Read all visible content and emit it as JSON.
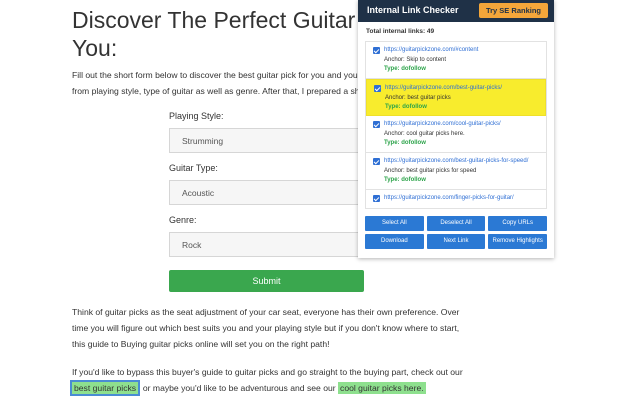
{
  "page": {
    "title_line1": "Discover The Perfect Guitar P",
    "title_line2": "You:",
    "intro_line1": "Fill out the short form below to discover the best guitar pick for you and your pl",
    "intro_line2": "from playing style, type of guitar as well as genre. After that, I prepared a short l",
    "form": {
      "fields": [
        {
          "label": "Playing Style:",
          "value": "Strumming"
        },
        {
          "label": "Guitar Type:",
          "value": "Acoustic"
        },
        {
          "label": "Genre:",
          "value": "Rock"
        }
      ],
      "submit_label": "Submit"
    },
    "para1": "Think of guitar picks as the seat adjustment of your car seat, everyone has their own preference. Over time you will figure out which best suits you and your playing style but if you don't know where to start, this guide to Buying guitar picks online will set you on the right path!",
    "para2_start": "If you'd like to bypass this buyer's guide to guitar picks and go straight to the buying part, check out our",
    "para2_link1": "best guitar picks",
    "para2_middle": ", or maybe you'd like to be adventurous and see our",
    "para2_link2": "cool guitar picks here."
  },
  "panel": {
    "title": "Internal Link Checker",
    "cta": "Try SE Ranking",
    "total_label": "Total internal links:",
    "total_count": "49",
    "anchor_prefix": "Anchor:",
    "type_prefix": "Type:",
    "links": [
      {
        "url": "https://guitarpickzone.com/#content",
        "anchor": "Skip to content",
        "type": "dofollow",
        "selected": false
      },
      {
        "url": "https://guitarpickzone.com/best-guitar-picks/",
        "anchor": "best guitar picks",
        "type": "dofollow",
        "selected": true
      },
      {
        "url": "https://guitarpickzone.com/cool-guitar-picks/",
        "anchor": "cool guitar picks here.",
        "type": "dofollow",
        "selected": false
      },
      {
        "url": "https://guitarpickzone.com/best-guitar-picks-for-speed/",
        "anchor": "best guitar picks for speed",
        "type": "dofollow",
        "selected": false
      },
      {
        "url": "https://guitarpickzone.com/finger-picks-for-guitar/",
        "anchor": "",
        "type": "",
        "selected": false
      }
    ],
    "buttons": [
      "Select All",
      "Deselect All",
      "Copy URLs",
      "Download",
      "Next Link",
      "Remove Highlights"
    ],
    "colors": {
      "header": "#1f3147",
      "cta": "#f4a63a",
      "button": "#2b79d4",
      "highlight": "#f8ec2d",
      "dofollow": "#2ca34a"
    }
  }
}
